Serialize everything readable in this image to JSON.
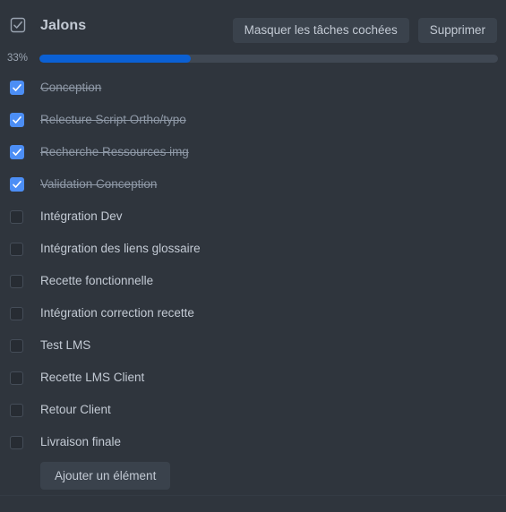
{
  "header": {
    "icon": "checkbox-checked-icon",
    "title": "Jalons",
    "buttons": [
      {
        "name": "hide-checked-tasks-button",
        "label": "Masquer les tâches cochées"
      },
      {
        "name": "delete-button",
        "label": "Supprimer"
      }
    ]
  },
  "progress": {
    "label": "33%",
    "percent": 33,
    "fill_color": "#0b60d4",
    "track_color": "#404853"
  },
  "tasks": [
    {
      "label": "Conception",
      "checked": true
    },
    {
      "label": "Relecture Script Ortho/typo",
      "checked": true
    },
    {
      "label": "Recherche Ressources img",
      "checked": true
    },
    {
      "label": "Validation Conception",
      "checked": true
    },
    {
      "label": "Intégration Dev",
      "checked": false
    },
    {
      "label": "Intégration des liens glossaire",
      "checked": false
    },
    {
      "label": "Recette fonctionnelle",
      "checked": false
    },
    {
      "label": "Intégration correction recette",
      "checked": false
    },
    {
      "label": "Test LMS",
      "checked": false
    },
    {
      "label": "Recette LMS Client",
      "checked": false
    },
    {
      "label": "Retour Client",
      "checked": false
    },
    {
      "label": "Livraison finale",
      "checked": false
    }
  ],
  "footer": {
    "add_item_label": "Ajouter un élément"
  },
  "theme": {
    "background": "#2f353d",
    "text": "#c3cad4",
    "muted_text": "#8e98a6",
    "button_bg": "#3a424c",
    "accent": "#4c8ef5"
  }
}
